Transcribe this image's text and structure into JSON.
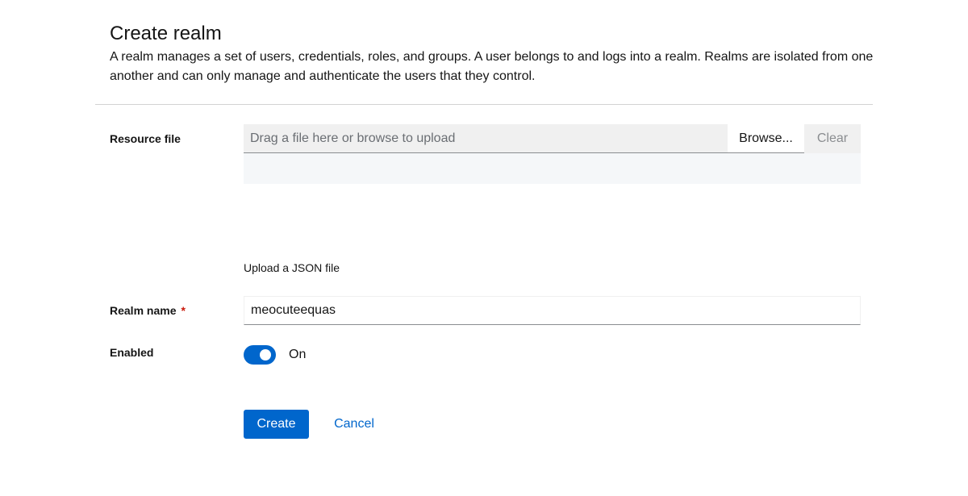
{
  "header": {
    "title": "Create realm",
    "description": "A realm manages a set of users, credentials, roles, and groups. A user belongs to and logs into a realm. Realms are isolated from one another and can only manage and authenticate the users that they control."
  },
  "resource_file": {
    "label": "Resource file",
    "placeholder": "Drag a file here or browse to upload",
    "browse_label": "Browse...",
    "clear_label": "Clear",
    "helper_text": "Upload a JSON file"
  },
  "realm_name": {
    "label": "Realm name",
    "required_marker": "*",
    "value": "meocuteequas"
  },
  "enabled": {
    "label": "Enabled",
    "state_label": "On",
    "checked": true
  },
  "actions": {
    "create_label": "Create",
    "cancel_label": "Cancel"
  },
  "colors": {
    "primary": "#0066cc",
    "required": "#c9190b"
  }
}
